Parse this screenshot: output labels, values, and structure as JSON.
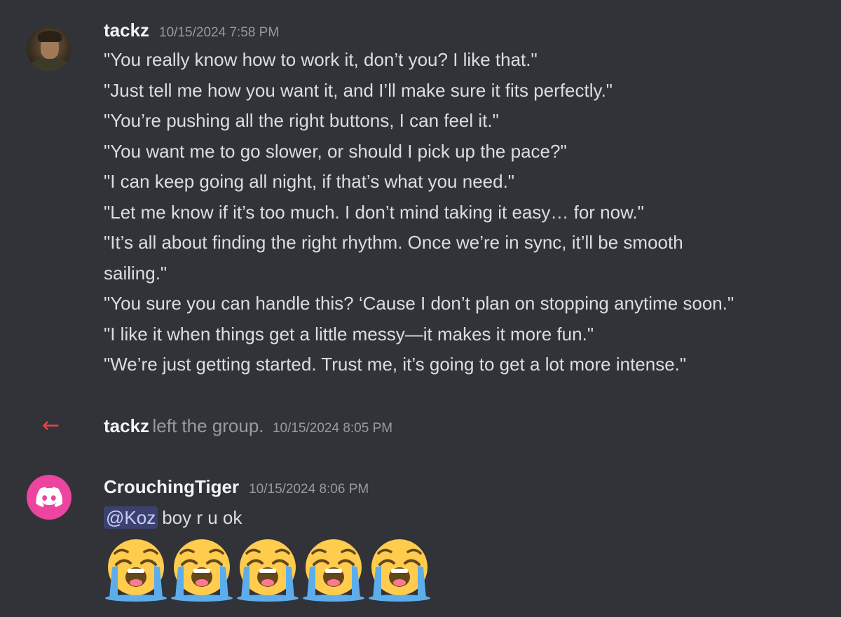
{
  "messages": [
    {
      "author": "tackz",
      "timestamp": "10/15/2024 7:58 PM",
      "avatar": "user-photo-avatar",
      "lines": [
        "\"You really know how to work it, don’t you? I like that.\"",
        "\"Just tell me how you want it, and I’ll make sure it fits perfectly.\"",
        "\"You’re pushing all the right buttons, I can feel it.\"",
        "\"You want me to go slower, or should I pick up the pace?\"",
        "\"I can keep going all night, if that’s what you need.\"",
        "\"Let me know if it’s too much. I don’t mind taking it easy… for now.\"",
        "\"It’s all about finding the right rhythm. Once we’re in sync, it’ll be smooth",
        "sailing.\"",
        "\"You sure you can handle this? ‘Cause I don’t plan on stopping anytime soon.\"",
        "\"I like it when things get a little messy—it makes it more fun.\"",
        "\"We’re just getting started. Trust me, it’s going to get a lot more intense.\""
      ]
    }
  ],
  "system_event": {
    "icon": "arrow-left-icon",
    "user": "tackz",
    "text": "left the group.",
    "timestamp": "10/15/2024 8:05 PM",
    "color": "#f23f43"
  },
  "reply": {
    "author": "CrouchingTiger",
    "timestamp": "10/15/2024 8:06 PM",
    "avatar": "discord-logo-icon",
    "avatar_color": "#eb459f",
    "mention": "@Koz",
    "text": "boy r u ok",
    "emojis": [
      "loudly-crying-face-icon",
      "loudly-crying-face-icon",
      "loudly-crying-face-icon",
      "loudly-crying-face-icon",
      "loudly-crying-face-icon"
    ]
  }
}
